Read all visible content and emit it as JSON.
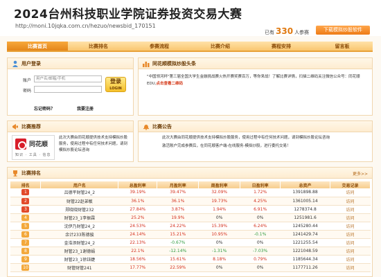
{
  "header": {
    "title": "2024台州科技职业学院证券投资交易大赛",
    "url": "http://moni.10jqka.com.cn/hezuo/newsbid_170151",
    "participants_prefix": "已有",
    "participants_count": "330",
    "participants_suffix": "人参赛",
    "download_label": "下载模拟炒股软件"
  },
  "nav": [
    "比赛首页",
    "比赛排名",
    "参赛流程",
    "比赛介绍",
    "赛程安排",
    "留言板"
  ],
  "login": {
    "title": "用户登录",
    "account_label": "账户",
    "account_placeholder": "用户名/邮箱/手机",
    "password_label": "密码",
    "button_label": "登录",
    "button_sub": "LOGIN",
    "forgot_label": "忘记密码？",
    "register_label": "我要注册"
  },
  "headline": {
    "title": "同花顺模拟炒股头条",
    "text_prefix": "\"中国领河杯\"第三届全国大学生金融挑战赛火热开赛奖赛百万，等你来战！了解比赛详情，扫描二维码关注微信公众号：同花顺EDU,",
    "text_highlight": "点击查看二维码"
  },
  "recommend": {
    "title": "比赛推荐",
    "logo_name": "同花顺",
    "logo_tag": "知识 · 工具 · 信息",
    "text": "此次大赛由同花顺提供技术支持模拟炒股服务，使用过程中有任何技术问题，请到模拟炒股论坛咨询"
  },
  "notice": {
    "title": "比赛公告",
    "items": [
      "此次大赛由同花顺提供技术支持模拟炒股服务，使用过程中有任何技术问题，请到模拟炒股论坛咨询",
      "激活账户完成参赛后，在同花顺客户端-在线服务-模拟炒股，进行委托交易！"
    ]
  },
  "ranking": {
    "title": "比赛排名",
    "more_label": "更多>>",
    "columns": [
      "排名",
      "用户名",
      "总盈利率",
      "月盈利率",
      "周盈利率",
      "日盈利率",
      "总资产",
      "交易记录"
    ],
    "rows": [
      {
        "rank": "1",
        "user": "吕德平财管24_2",
        "total": "39.19%",
        "month": "39.47%",
        "week": "32.09%",
        "day": "1.72%",
        "assets": "1391898.88",
        "link": "访问"
      },
      {
        "rank": "2",
        "user": "财管22赵弟敏",
        "total": "36.1%",
        "month": "36.1%",
        "week": "19.73%",
        "day": "4.25%",
        "assets": "1361005.14",
        "link": "访问"
      },
      {
        "rank": "3",
        "user": "郑晓晓财管232",
        "total": "27.84%",
        "month": "3.87%",
        "week": "1.94%",
        "day": "6.91%",
        "assets": "1278374.8",
        "link": "访问"
      },
      {
        "rank": "4",
        "user": "财管23_1李振霖",
        "total": "25.2%",
        "month": "19.9%",
        "week": "0%",
        "day": "0%",
        "assets": "1251981.6",
        "link": "访问"
      },
      {
        "rank": "5",
        "user": "沈伊乃财管24_2",
        "total": "24.53%",
        "month": "24.22%",
        "week": "15.39%",
        "day": "6.24%",
        "assets": "1245280.44",
        "link": "访问"
      },
      {
        "rank": "6",
        "user": "余计233陈德骏",
        "total": "24.14%",
        "month": "15.21%",
        "week": "10.95%",
        "day": "-0.1%",
        "assets": "1241429.74",
        "link": "访问"
      },
      {
        "rank": "7",
        "user": "金浩添财管24_2",
        "total": "22.13%",
        "month": "-0.67%",
        "week": "0%",
        "day": "0%",
        "assets": "1221255.54",
        "link": "访问"
      },
      {
        "rank": "8",
        "user": "财管23_1谢德娟",
        "total": "22.1%",
        "month": "-12.14%",
        "week": "-1.31%",
        "day": "-7.03%",
        "assets": "1221048.59",
        "link": "访问"
      },
      {
        "rank": "9",
        "user": "财管23_1徐钰婕",
        "total": "18.56%",
        "month": "15.61%",
        "week": "8.18%",
        "day": "0.79%",
        "assets": "1185644.34",
        "link": "访问"
      },
      {
        "rank": "10",
        "user": "财管财管241",
        "total": "17.77%",
        "month": "22.59%",
        "week": "0%",
        "day": "0%",
        "assets": "1177711.26",
        "link": "访问"
      }
    ]
  }
}
